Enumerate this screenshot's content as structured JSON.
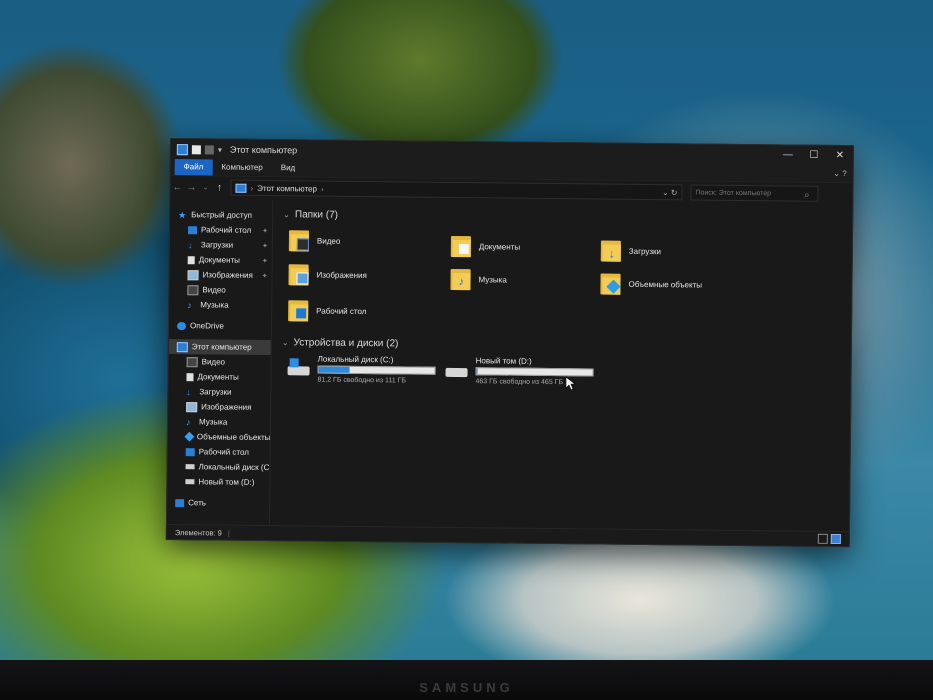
{
  "titlebar": {
    "title": "Этот компьютер"
  },
  "ribbon": {
    "tabs": [
      "Файл",
      "Компьютер",
      "Вид"
    ]
  },
  "address": {
    "path": "Этот компьютер",
    "search_placeholder": "Поиск: Этот компьютер"
  },
  "sidebar": {
    "quick_access": {
      "label": "Быстрый доступ",
      "items": [
        "Рабочий стол",
        "Загрузки",
        "Документы",
        "Изображения",
        "Видео",
        "Музыка"
      ]
    },
    "onedrive": "OneDrive",
    "this_pc": {
      "label": "Этот компьютер",
      "items": [
        "Видео",
        "Документы",
        "Загрузки",
        "Изображения",
        "Музыка",
        "Объемные объекты",
        "Рабочий стол",
        "Локальный диск (C",
        "Новый том (D:)"
      ]
    },
    "network": "Сеть"
  },
  "folders": {
    "header": "Папки (7)",
    "items": [
      "Видео",
      "Документы",
      "Загрузки",
      "Изображения",
      "Музыка",
      "Объемные объекты",
      "Рабочий стол"
    ]
  },
  "drives": {
    "header": "Устройства и диски (2)",
    "items": [
      {
        "name": "Локальный диск (C:)",
        "free_text": "81,2 ГБ свободно из 111 ГБ",
        "used_fraction": 0.27
      },
      {
        "name": "Новый том (D:)",
        "free_text": "463 ГБ свободно из 465 ГБ",
        "used_fraction": 0.004
      }
    ]
  },
  "status": {
    "count": "Элементов: 9",
    "separator": "|"
  },
  "monitor": {
    "brand": "SAMSUNG"
  },
  "colors": {
    "accent": "#1b66c4",
    "folder": "#f3cc55",
    "drive_bar": "#2f8ad8",
    "window_bg": "#191919"
  }
}
